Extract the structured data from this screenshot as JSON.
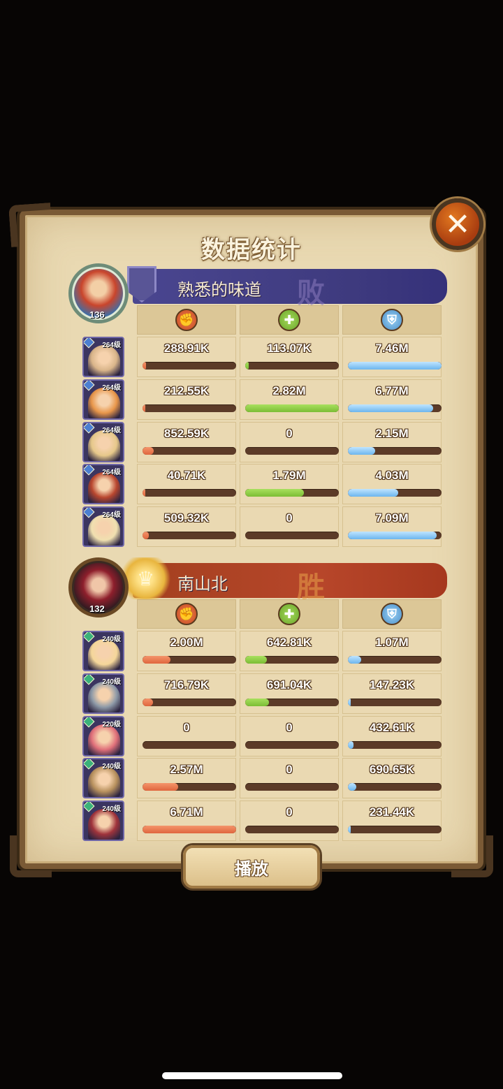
{
  "title": "数据统计",
  "close_label": "✕",
  "play_label": "播放",
  "stat_icons": [
    "damage-icon",
    "heal-icon",
    "shield-icon"
  ],
  "colors": {
    "damage": "#e0663e",
    "heal": "#7bbd35",
    "shield": "#6cb6ee",
    "lose_banner": "#3e3a7e",
    "win_banner": "#b7462a"
  },
  "teams": [
    {
      "name": "熟悉的味道",
      "result": "败",
      "leader_level": "136",
      "heroes": [
        {
          "level": "264级",
          "damage": "288.91K",
          "damage_pct": 0.04,
          "heal": "113.07K",
          "heal_pct": 0.04,
          "shield": "7.46M",
          "shield_pct": 1.0,
          "color": "#d9b58a"
        },
        {
          "level": "264级",
          "damage": "212.55K",
          "damage_pct": 0.03,
          "heal": "2.82M",
          "heal_pct": 1.0,
          "shield": "6.77M",
          "shield_pct": 0.91,
          "color": "#e8964a"
        },
        {
          "level": "264级",
          "damage": "852.59K",
          "damage_pct": 0.12,
          "heal": "0",
          "heal_pct": 0,
          "shield": "2.15M",
          "shield_pct": 0.29,
          "color": "#e6c88a"
        },
        {
          "level": "264级",
          "damage": "40.71K",
          "damage_pct": 0.01,
          "heal": "1.79M",
          "heal_pct": 0.63,
          "shield": "4.03M",
          "shield_pct": 0.54,
          "color": "#b9472f"
        },
        {
          "level": "264级",
          "damage": "509.32K",
          "damage_pct": 0.07,
          "heal": "0",
          "heal_pct": 0,
          "shield": "7.09M",
          "shield_pct": 0.95,
          "color": "#f0e0b0"
        }
      ]
    },
    {
      "name": "南山北",
      "result": "胜",
      "leader_level": "132",
      "heroes": [
        {
          "level": "240级",
          "damage": "2.00M",
          "damage_pct": 0.3,
          "heal": "642.81K",
          "heal_pct": 0.23,
          "shield": "1.07M",
          "shield_pct": 0.14,
          "color": "#f5d79a"
        },
        {
          "level": "240级",
          "damage": "716.79K",
          "damage_pct": 0.11,
          "heal": "691.04K",
          "heal_pct": 0.25,
          "shield": "147.23K",
          "shield_pct": 0.02,
          "color": "#8e9aa8"
        },
        {
          "level": "220级",
          "damage": "0",
          "damage_pct": 0,
          "heal": "0",
          "heal_pct": 0,
          "shield": "432.61K",
          "shield_pct": 0.06,
          "color": "#e0707a"
        },
        {
          "level": "240级",
          "damage": "2.57M",
          "damage_pct": 0.38,
          "heal": "0",
          "heal_pct": 0,
          "shield": "690.65K",
          "shield_pct": 0.09,
          "color": "#b8915e"
        },
        {
          "level": "240级",
          "damage": "6.71M",
          "damage_pct": 1.0,
          "heal": "0",
          "heal_pct": 0,
          "shield": "231.44K",
          "shield_pct": 0.03,
          "color": "#a0343c"
        }
      ]
    }
  ]
}
